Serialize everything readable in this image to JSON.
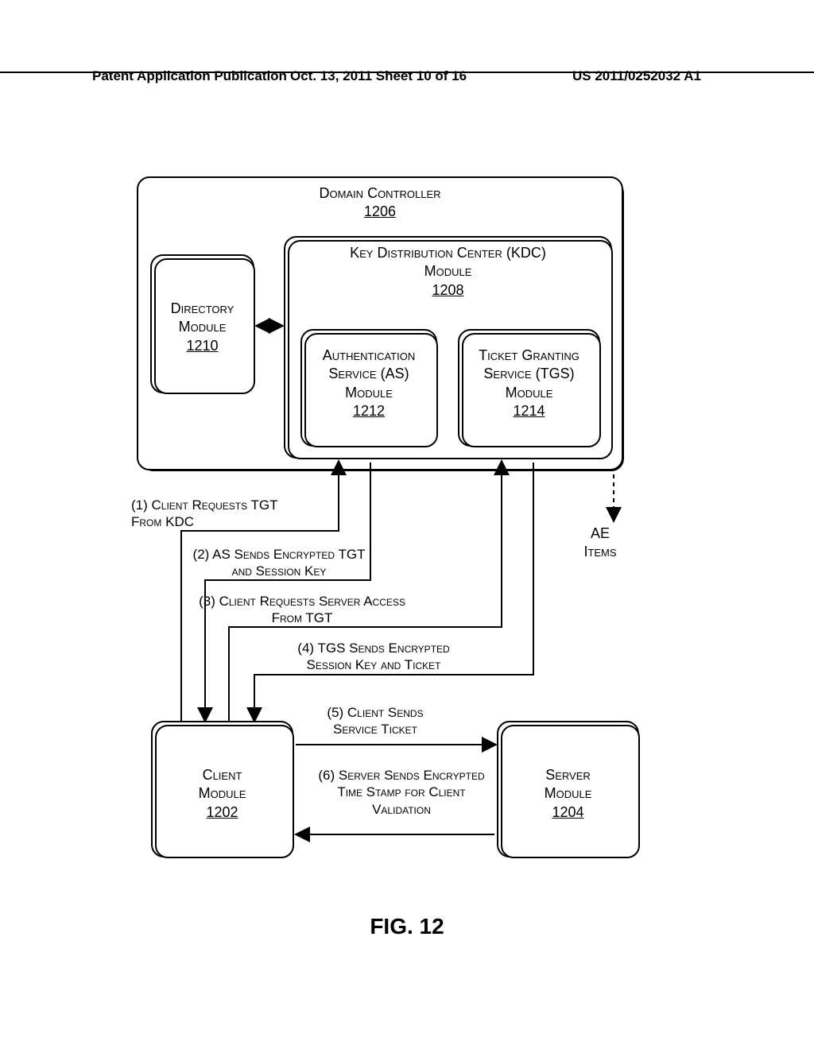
{
  "header": {
    "left": "Patent Application Publication",
    "mid": "Oct. 13, 2011  Sheet 10 of 16",
    "right": "US 2011/0252032 A1"
  },
  "domain_controller": {
    "title": "Domain Controller",
    "ref": "1206"
  },
  "directory": {
    "title": "Directory Module",
    "ref": "1210"
  },
  "kdc": {
    "title": "Key Distribution Center (KDC) Module",
    "ref": "1208"
  },
  "as": {
    "title": "Authentication Service (AS) Module",
    "ref": "1212"
  },
  "tgs": {
    "title": "Ticket Granting Service (TGS) Module",
    "ref": "1214"
  },
  "ae": {
    "title": "AE Items"
  },
  "client": {
    "title": "Client Module",
    "ref": "1202"
  },
  "server": {
    "title": "Server Module",
    "ref": "1204"
  },
  "steps": {
    "s1": "(1) Client Requests TGT From KDC",
    "s2": "(2) AS Sends Encrypted TGT and Session Key",
    "s3": "(3) Client Requests Server Access From TGT",
    "s4": "(4) TGS Sends Encrypted Session Key and Ticket",
    "s5": "(5) Client Sends Service Ticket",
    "s6": "(6) Server Sends Encrypted Time Stamp for Client Validation"
  },
  "figure": "FIG. 12"
}
